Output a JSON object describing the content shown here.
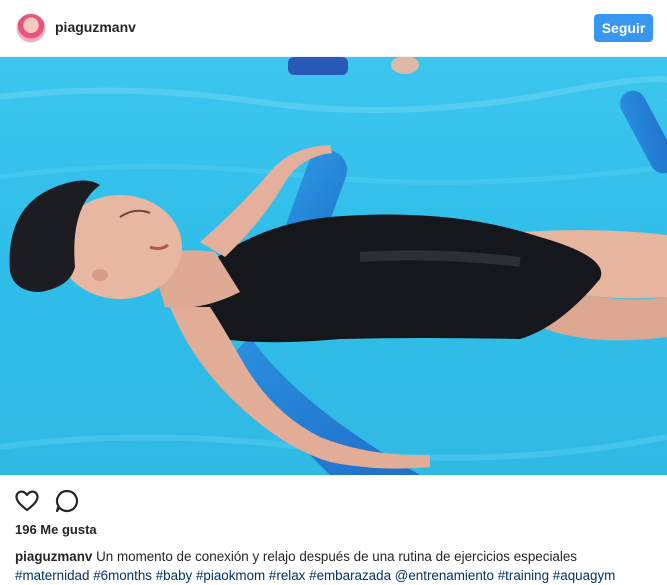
{
  "post": {
    "username": "piaguzmanv",
    "follow_label": "Seguir",
    "likes_text": "196 Me gusta",
    "caption_text": "Un momento de conexión y relajo después de una rutina de ejercicios especiales",
    "tags": [
      "#maternidad",
      "#6months",
      "#baby",
      "#piaokmom",
      "#relax",
      "#embarazada",
      "@entrenamiento",
      "#training",
      "#aquagym"
    ]
  },
  "icons": {
    "like": "heart-icon",
    "comment": "comment-bubble-icon"
  },
  "colors": {
    "accent": "#3897f0",
    "hashtag": "#003569",
    "pool_water": "#33c1ea"
  }
}
